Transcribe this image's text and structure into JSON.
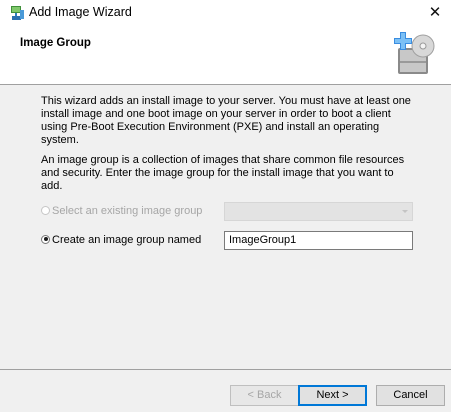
{
  "window": {
    "title": "Add Image Wizard",
    "close_glyph": "✕"
  },
  "header": {
    "title": "Image Group"
  },
  "intro_text": "This wizard adds an install image to your server. You must have at least one install image and one boot image on your server in order to boot a client using Pre-Boot Execution Environment (PXE) and install an operating system.",
  "group_text": "An image group is a collection of images that share common file resources and security. Enter the image group for the install image that you want to add.",
  "options": {
    "existing": {
      "label": "Select an existing image group",
      "selected": false,
      "enabled": false
    },
    "create": {
      "label": "Create an image group named",
      "selected": true,
      "enabled": true
    }
  },
  "existing_select": {
    "value": ""
  },
  "group_name_input": {
    "value": "ImageGroup1"
  },
  "buttons": {
    "back": "< Back",
    "next": "Next >",
    "cancel": "Cancel"
  },
  "icons": {
    "app": "wds-app-icon",
    "wizard": "add-image-wizard-icon"
  }
}
